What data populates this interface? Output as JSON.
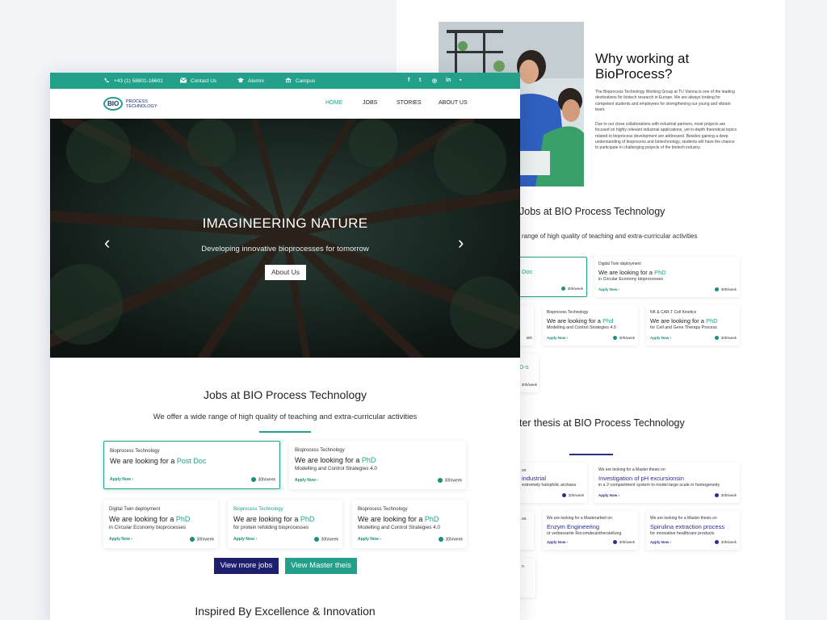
{
  "back": {
    "why_title": "Why working at BioProcess?",
    "why_p1": "The Bioprocess Technology Working Group at TU Vienna is one of the leading destinations for biotech research in Europe. We are always looking for competent students and employees for strengthening our young and vibrant team.",
    "why_p2": "Due to our close collaborations with industrial partners, most projects are focused on highly relevant industrial applications, yet in-depth theoretical topics related to bioprocess development are addressed. Besides gaining a deep understanding of bioprocess and biotechnology, students will have the chance to participate in challenging projects of the biotech industry.",
    "jobs_title": "Jobs at BIO Process Technology",
    "jobs_sub": "range of high quality of teaching and extra-curricular activities",
    "frag_doc": "Doc",
    "frag_s": "D-s",
    "jobs": [
      {
        "cat": "Digital Twin deployment",
        "prefix": "We are looking for a ",
        "role": "PhD",
        "desc": "in Circular Economy bioprocesses",
        "apply": "Apply Now  ›",
        "hours": "30h/week"
      },
      {
        "cat": "Bioprocess Technology",
        "prefix": "We are looking for a ",
        "role": "Phd",
        "desc": "Modelling and Control Strategies 4.0",
        "apply": "Apply Now  ›",
        "hours": "30h/week"
      },
      {
        "cat": "NK & CAR-T Cell Kinetics",
        "prefix": "We are looking for a ",
        "role": "PhD",
        "desc": "for Cell and Gene Therapy Process",
        "apply": "Apply Now  ›",
        "hours": "30h/week"
      }
    ],
    "frag_hours": "30h/week",
    "thesis_title": "ter thesis at BIO Process Technology",
    "theses": [
      {
        "cat": "",
        "prefix": "",
        "role": "industrial",
        "desc": "extremely halophilic archaea",
        "apply": "",
        "hours": "30h/week"
      },
      {
        "cat": "We are looking for a Master thesis on",
        "prefix": "",
        "role": "Investigation of pH excursionsin",
        "desc": "in a 2-compartment system to model large scale in homogeneity",
        "apply": "Apply Now  ›",
        "hours": "30h/week"
      },
      {
        "cat": "We are looking for a Masterarbeit on",
        "prefix": "",
        "role": "Enzym Engineering",
        "desc": "ür verbesserte Rocomdeuintherstellung",
        "apply": "Apply Now  ›",
        "hours": "30h/week"
      },
      {
        "cat": "We are looking for a Master thesis on",
        "prefix": "",
        "role": "Spirulina extraction process",
        "desc": "for innovative healthcare products",
        "apply": "Apply Now  ›",
        "hours": "30h/week"
      }
    ],
    "frag_on": "on",
    "frag_n": "n"
  },
  "topbar": {
    "phone": "+43 (1) 58801-16601",
    "contact": "Contact Us",
    "alumni": "Alumni",
    "campus": "Campus",
    "social": [
      "f",
      "t",
      "◎",
      "in",
      "▪"
    ]
  },
  "nav": {
    "logo_bio": "BIO",
    "logo_l1": "PROCESS",
    "logo_l2": "TECHNOLOGY",
    "items": [
      "HOME",
      "JOBS",
      "STORIES",
      "ABOUT US"
    ]
  },
  "hero": {
    "title": "IMAGINEERING NATURE",
    "subtitle": "Developing innovative bioprocesses for tomorrow",
    "button": "About Us",
    "prev": "‹",
    "next": "›"
  },
  "jobs": {
    "title": "Jobs at BIO Process Technology",
    "subtitle": "We offer a wide range of high quality of teaching and extra-curricular activities",
    "cards": [
      {
        "cat": "Bioprocess Technology",
        "prefix": "We are looking for a ",
        "role": "Post Doc",
        "desc": "",
        "apply": "Apply Now  ›",
        "hours": "30h/week"
      },
      {
        "cat": "Bioprocess Technology",
        "prefix": "We are looking for a ",
        "role": "PhD",
        "desc": "Modelling and Control Strategies 4.0",
        "apply": "Apply Now  ›",
        "hours": "30h/week"
      },
      {
        "cat": "Digital Twin deployment",
        "prefix": "We are looking for a ",
        "role": "PhD",
        "desc": "in Circular Economy bioprocesses",
        "apply": "Apply Now  ›",
        "hours": "30h/week"
      },
      {
        "cat": "Bioprocess Technology",
        "prefix": "We are looking for a ",
        "role": "PhD",
        "desc": "for protein refolding bioprocesses",
        "apply": "Apply Now  ›",
        "hours": "30h/week"
      },
      {
        "cat": "Bioprocess Technology",
        "prefix": "We are looking for a ",
        "role": "PhD",
        "desc": "Modelling and Control Strategies 4.0",
        "apply": "Apply Now  ›",
        "hours": "30h/week"
      }
    ],
    "more_button": "View more jobs",
    "master_button": "View Master theis"
  },
  "inspired_title": "Inspired By Excellence & Innovation",
  "colors": {
    "teal": "#22a08a",
    "navy": "#1e1e6e"
  }
}
